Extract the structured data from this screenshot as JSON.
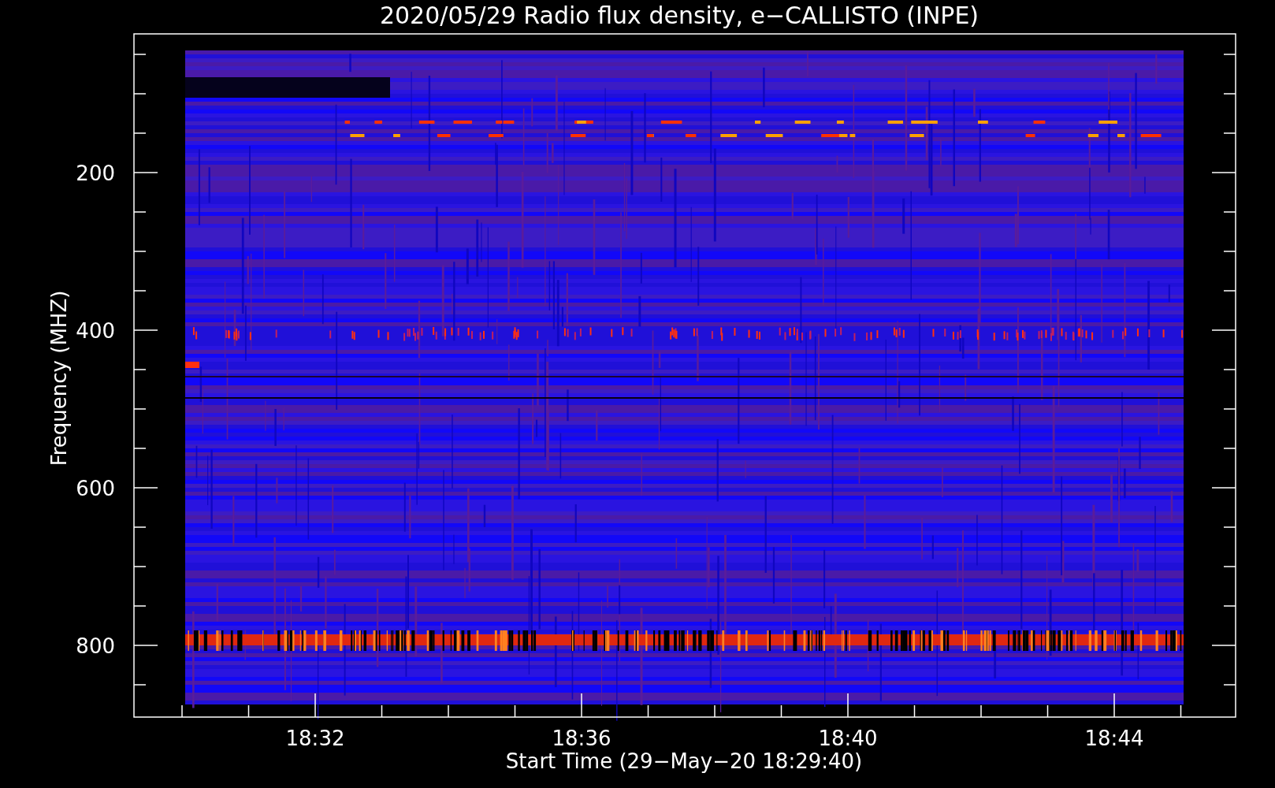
{
  "title": "2020/05/29  Radio flux density, e−CALLISTO (INPE)",
  "y_axis": {
    "label": "Frequency (MHZ)",
    "ticks": [
      "200",
      "400",
      "600",
      "800"
    ]
  },
  "x_axis": {
    "label": "Start Time (29−May−20 18:29:40)",
    "ticks": [
      "18:32",
      "18:36",
      "18:40",
      "18:44"
    ]
  }
}
